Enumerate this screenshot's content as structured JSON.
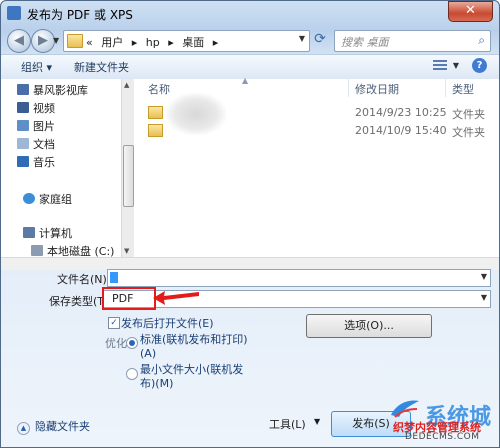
{
  "window": {
    "title": "发布为 PDF 或 XPS",
    "close_label": "✕"
  },
  "nav": {
    "back_icon": "back-arrow-icon",
    "forward_icon": "forward-arrow-icon",
    "breadcrumb": [
      "«",
      "用户",
      "▸",
      "hp",
      "▸",
      "桌面",
      "▸"
    ],
    "search_placeholder": "搜索 桌面"
  },
  "toolbar": {
    "organize_label": "组织 ▾",
    "new_folder_label": "新建文件夹",
    "help_label": "?"
  },
  "sidebar": {
    "items": [
      {
        "label": "暴风影视库",
        "icon": "media-library-icon",
        "color": "#4a6fa8"
      },
      {
        "label": "视频",
        "icon": "video-icon",
        "color": "#3a5d92"
      },
      {
        "label": "图片",
        "icon": "picture-icon",
        "color": "#5e8fc7"
      },
      {
        "label": "文档",
        "icon": "document-icon",
        "color": "#9fb7d6"
      },
      {
        "label": "音乐",
        "icon": "music-icon",
        "color": "#2e6db5"
      },
      {
        "label": "家庭组",
        "icon": "homegroup-icon",
        "color": "#3c8dd6"
      },
      {
        "label": "计算机",
        "icon": "computer-icon",
        "color": "#5b7ba6"
      },
      {
        "label": "本地磁盘 (C:)",
        "icon": "drive-icon",
        "color": "#8b9bb0"
      }
    ]
  },
  "files": {
    "columns": [
      "名称",
      "修改日期",
      "类型"
    ],
    "rows": [
      {
        "name": "",
        "date": "2014/9/23 10:25",
        "type": "文件夹"
      },
      {
        "name": "",
        "date": "2014/10/9 15:40",
        "type": "文件夹"
      }
    ]
  },
  "form": {
    "filename_label": "文件名(N):",
    "filename_value": "",
    "savetype_label": "保存类型(T):",
    "savetype_value": "PDF",
    "open_after_label": "发布后打开文件(E)",
    "open_after_checked": true,
    "optimize_label": "优化:",
    "radio_standard_line1": "标准(联机发布和打印)",
    "radio_standard_line2": "(A)",
    "radio_min_line1": "最小文件大小(联机发",
    "radio_min_line2": "布)(M)",
    "options_button": "选项(O)...",
    "hide_folders_label": "隐藏文件夹",
    "tools_label": "工具(L)",
    "publish_button": "发布(S)"
  },
  "watermark": {
    "big": "系统城",
    "line1": "织梦内容管理系统",
    "line2": "DEDECMS.COM"
  },
  "colors": {
    "highlight_box": "#e31b1b",
    "link_text": "#1a3e76"
  }
}
